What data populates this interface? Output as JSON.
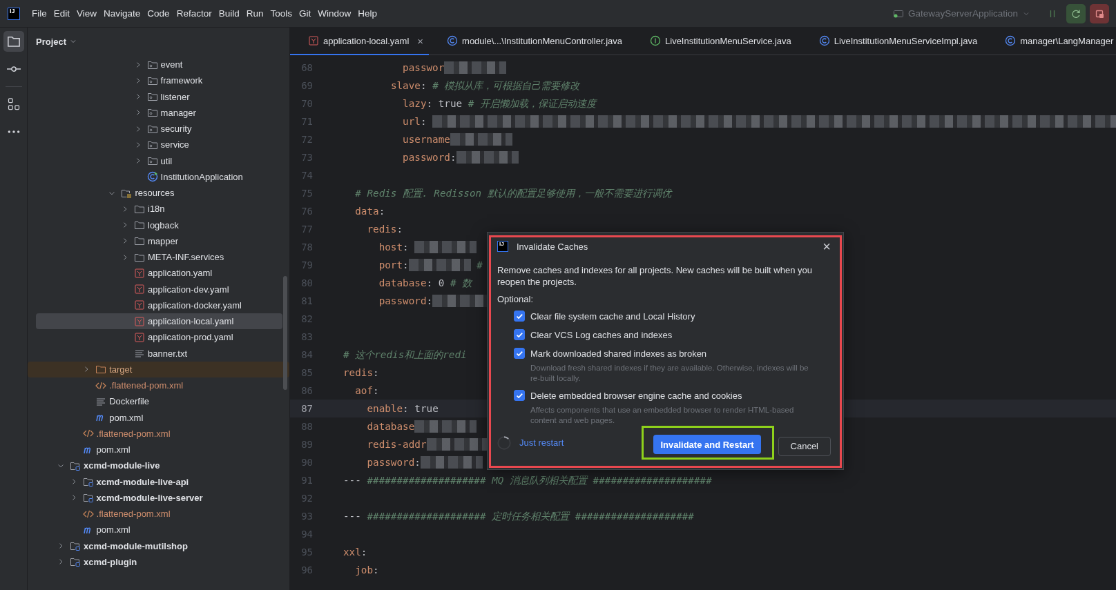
{
  "app_logo": "IJ",
  "menu": [
    "File",
    "Edit",
    "View",
    "Navigate",
    "Code",
    "Refactor",
    "Build",
    "Run",
    "Tools",
    "Git",
    "Window",
    "Help"
  ],
  "run_config": {
    "label": "GatewayServerApplication"
  },
  "tool_strip": [
    {
      "kind": "project",
      "selected": true
    },
    {
      "kind": "commit",
      "selected": false
    },
    {
      "kind": "structure",
      "selected": false
    },
    {
      "kind": "more",
      "selected": false
    }
  ],
  "project_panel": {
    "title": "Project",
    "tree": [
      {
        "children": [
          {
            "children": [
              {
                "children": [
                  {
                    "children": [
                      {
                        "children": [
                          {
                            "children": [
                              {
                                "label": "event",
                                "kind": "package",
                                "expanded": false,
                                "selected": false
                              },
                              {
                                "label": "framework",
                                "kind": "package",
                                "expanded": false,
                                "selected": false
                              },
                              {
                                "label": "listener",
                                "kind": "package",
                                "expanded": false,
                                "selected": false
                              },
                              {
                                "label": "manager",
                                "kind": "package",
                                "expanded": false,
                                "selected": false
                              },
                              {
                                "label": "security",
                                "kind": "package",
                                "expanded": false,
                                "selected": false
                              },
                              {
                                "label": "service",
                                "kind": "package",
                                "expanded": false,
                                "selected": false
                              },
                              {
                                "label": "util",
                                "kind": "package",
                                "expanded": false,
                                "selected": false
                              },
                              {
                                "label": "InstitutionApplication",
                                "kind": "class",
                                "selected": false
                              }
                            ]
                          }
                        ]
                      },
                      {
                        "label": "resources",
                        "kind": "resources",
                        "expanded": true,
                        "selected": false,
                        "children": [
                          {
                            "label": "i18n",
                            "kind": "folder",
                            "expanded": false,
                            "selected": false
                          },
                          {
                            "label": "logback",
                            "kind": "folder",
                            "expanded": false,
                            "selected": false
                          },
                          {
                            "label": "mapper",
                            "kind": "folder",
                            "expanded": false,
                            "selected": false
                          },
                          {
                            "label": "META-INF.services",
                            "kind": "folder",
                            "expanded": false,
                            "selected": false
                          },
                          {
                            "label": "application.yaml",
                            "kind": "yaml",
                            "selected": false
                          },
                          {
                            "label": "application-dev.yaml",
                            "kind": "yaml",
                            "selected": false
                          },
                          {
                            "label": "application-docker.yaml",
                            "kind": "yaml",
                            "selected": false
                          },
                          {
                            "label": "application-local.yaml",
                            "kind": "yaml",
                            "selected": true
                          },
                          {
                            "label": "application-prod.yaml",
                            "kind": "yaml",
                            "selected": false
                          },
                          {
                            "label": "banner.txt",
                            "kind": "text",
                            "selected": false
                          }
                        ]
                      }
                    ]
                  }
                ]
              },
              {
                "label": "target",
                "kind": "excluded",
                "expanded": false,
                "selected": false
              },
              {
                "label": ".flattened-pom.xml",
                "kind": "xml",
                "selected": false
              },
              {
                "label": "Dockerfile",
                "kind": "text",
                "selected": false
              },
              {
                "label": "pom.xml",
                "kind": "maven",
                "selected": false
              }
            ]
          },
          {
            "label": ".flattened-pom.xml",
            "kind": "xml",
            "selected": false
          },
          {
            "label": "pom.xml",
            "kind": "maven",
            "selected": false
          }
        ]
      },
      {
        "label": "xcmd-module-live",
        "kind": "module",
        "expanded": true,
        "selected": false,
        "children": [
          {
            "label": "xcmd-module-live-api",
            "kind": "module",
            "expanded": false,
            "selected": false
          },
          {
            "label": "xcmd-module-live-server",
            "kind": "module",
            "expanded": false,
            "selected": false
          },
          {
            "label": ".flattened-pom.xml",
            "kind": "xml",
            "selected": false
          },
          {
            "label": "pom.xml",
            "kind": "maven",
            "selected": false
          }
        ]
      },
      {
        "label": "xcmd-module-mutilshop",
        "kind": "module",
        "expanded": false,
        "selected": false
      },
      {
        "label": "xcmd-plugin",
        "kind": "module",
        "expanded": false,
        "selected": false
      }
    ]
  },
  "tabs": [
    {
      "label": "application-local.yaml",
      "kind": "yaml",
      "selected": true,
      "close": "×"
    },
    {
      "label": "module\\...\\InstitutionMenuController.java",
      "kind": "class",
      "selected": false
    },
    {
      "label": "LiveInstitutionMenuService.java",
      "kind": "interface",
      "selected": false
    },
    {
      "label": "LiveInstitutionMenuServiceImpl.java",
      "kind": "class",
      "selected": false
    },
    {
      "label": "manager\\LangManager",
      "kind": "class",
      "selected": false
    }
  ],
  "editor": {
    "lines": [
      {
        "n": "68",
        "current": false,
        "tokens": [
          {
            "kind": "key",
            "text": "          passwor"
          },
          {
            "kind": "redacted"
          }
        ]
      },
      {
        "n": "69",
        "current": false,
        "tokens": [
          {
            "kind": "key",
            "text": "        slave"
          },
          {
            "kind": "punct",
            "text": ":"
          },
          {
            "kind": "comment",
            "text": " # 模拟从库，可根据自己需要修改"
          }
        ]
      },
      {
        "n": "70",
        "current": false,
        "tokens": [
          {
            "kind": "key",
            "text": "          lazy"
          },
          {
            "kind": "punct",
            "text": ": "
          },
          {
            "kind": "value",
            "text": "true"
          },
          {
            "kind": "comment",
            "text": " # 开启懒加载，保证启动速度"
          }
        ]
      },
      {
        "n": "71",
        "current": false,
        "tokens": [
          {
            "kind": "key",
            "text": "          url"
          },
          {
            "kind": "punct",
            "text": ": "
          },
          {
            "kind": "redacted_long"
          }
        ]
      },
      {
        "n": "72",
        "current": false,
        "tokens": [
          {
            "kind": "key",
            "text": "          username"
          },
          {
            "kind": "redacted"
          }
        ]
      },
      {
        "n": "73",
        "current": false,
        "tokens": [
          {
            "kind": "key",
            "text": "          password"
          },
          {
            "kind": "punct",
            "text": ":"
          },
          {
            "kind": "redacted"
          }
        ]
      },
      {
        "n": "74",
        "current": false
      },
      {
        "n": "75",
        "current": false,
        "tokens": [
          {
            "kind": "comment",
            "text": "  # Redis 配置. Redisson 默认的配置足够使用，一般不需要进行调优"
          }
        ]
      },
      {
        "n": "76",
        "current": false,
        "tokens": [
          {
            "kind": "key",
            "text": "  data"
          },
          {
            "kind": "punct",
            "text": ":"
          }
        ]
      },
      {
        "n": "77",
        "current": false,
        "tokens": [
          {
            "kind": "key",
            "text": "    redis"
          },
          {
            "kind": "punct",
            "text": ":"
          }
        ]
      },
      {
        "n": "78",
        "current": false,
        "tokens": [
          {
            "kind": "key",
            "text": "      host"
          },
          {
            "kind": "punct",
            "text": ": "
          },
          {
            "kind": "redacted"
          }
        ]
      },
      {
        "n": "79",
        "current": false,
        "tokens": [
          {
            "kind": "key",
            "text": "      port"
          },
          {
            "kind": "punct",
            "text": ":"
          },
          {
            "kind": "redacted"
          },
          {
            "kind": "comment",
            "text": " #"
          }
        ]
      },
      {
        "n": "80",
        "current": false,
        "tokens": [
          {
            "kind": "key",
            "text": "      database"
          },
          {
            "kind": "punct",
            "text": ": "
          },
          {
            "kind": "value",
            "text": "0"
          },
          {
            "kind": "comment",
            "text": " # 数"
          }
        ]
      },
      {
        "n": "81",
        "current": false,
        "tokens": [
          {
            "kind": "key",
            "text": "      password"
          },
          {
            "kind": "punct",
            "text": ":"
          },
          {
            "kind": "redacted"
          }
        ]
      },
      {
        "n": "82",
        "current": false
      },
      {
        "n": "83",
        "current": false
      },
      {
        "n": "84",
        "current": false,
        "tokens": [
          {
            "kind": "comment",
            "text": "# 这个redis和上面的redi"
          }
        ]
      },
      {
        "n": "85",
        "current": false,
        "tokens": [
          {
            "kind": "key",
            "text": "redis"
          },
          {
            "kind": "punct",
            "text": ":"
          }
        ]
      },
      {
        "n": "86",
        "current": false,
        "tokens": [
          {
            "kind": "key",
            "text": "  aof"
          },
          {
            "kind": "punct",
            "text": ":"
          }
        ]
      },
      {
        "n": "87",
        "current": true,
        "tokens": [
          {
            "kind": "key",
            "text": "    enable"
          },
          {
            "kind": "punct",
            "text": ": "
          },
          {
            "kind": "value",
            "text": "true"
          }
        ]
      },
      {
        "n": "88",
        "current": false,
        "tokens": [
          {
            "kind": "key",
            "text": "    database"
          },
          {
            "kind": "redacted"
          }
        ]
      },
      {
        "n": "89",
        "current": false,
        "tokens": [
          {
            "kind": "key",
            "text": "    redis-addr"
          },
          {
            "kind": "redacted"
          }
        ]
      },
      {
        "n": "90",
        "current": false,
        "tokens": [
          {
            "kind": "key",
            "text": "    password"
          },
          {
            "kind": "punct",
            "text": ":"
          },
          {
            "kind": "redacted"
          }
        ]
      },
      {
        "n": "91",
        "current": false,
        "tokens": [
          {
            "kind": "punct",
            "text": "--- "
          },
          {
            "kind": "comment",
            "text": "#################### MQ 消息队列相关配置 ####################"
          }
        ]
      },
      {
        "n": "92",
        "current": false
      },
      {
        "n": "93",
        "current": false,
        "tokens": [
          {
            "kind": "punct",
            "text": "--- "
          },
          {
            "kind": "comment",
            "text": "#################### 定时任务相关配置 ####################"
          }
        ]
      },
      {
        "n": "94",
        "current": false
      },
      {
        "n": "95",
        "current": false,
        "tokens": [
          {
            "kind": "key",
            "text": "xxl"
          },
          {
            "kind": "punct",
            "text": ":"
          }
        ]
      },
      {
        "n": "96",
        "current": false,
        "tokens": [
          {
            "kind": "key",
            "text": "  job"
          },
          {
            "kind": "punct",
            "text": ":"
          }
        ]
      }
    ]
  },
  "dialog": {
    "logo": "IJ",
    "title": "Invalidate Caches",
    "close": "×",
    "description": "Remove caches and indexes for all projects. New caches will be built when you reopen the projects.",
    "optional_label": "Optional:",
    "options": [
      {
        "label": "Clear file system cache and Local History",
        "checked": true
      },
      {
        "label": "Clear VCS Log caches and indexes",
        "checked": true
      },
      {
        "label": "Mark downloaded shared indexes as broken",
        "checked": true,
        "hint": "Download fresh shared indexes if they are available. Otherwise, indexes will be re-built locally."
      },
      {
        "label": "Delete embedded browser engine cache and cookies",
        "checked": true,
        "hint": "Affects components that use an embedded browser to render HTML-based content and web pages."
      }
    ],
    "link": "Just restart",
    "primary_button": "Invalidate and Restart",
    "cancel_button": "Cancel"
  }
}
